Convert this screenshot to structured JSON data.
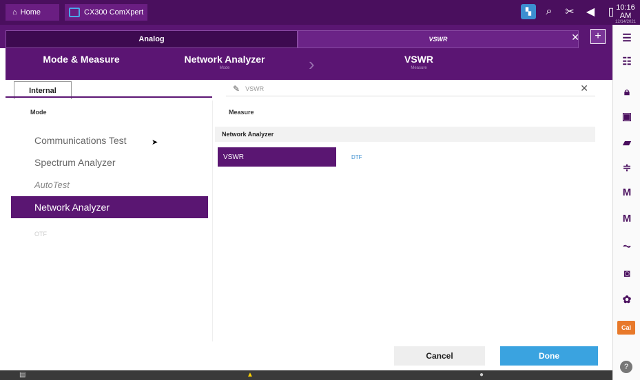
{
  "topbar": {
    "home_label": "Home",
    "app_label": "CX300 ComXpert",
    "clock_time": "10:16 AM",
    "clock_date": "12/14/2021",
    "status_icons": [
      "network-icon",
      "wifi-search-icon",
      "tools-icon",
      "volume-icon",
      "battery-icon"
    ]
  },
  "subtabs": {
    "tab1": "Analog",
    "tab2": "VSWR"
  },
  "breadcrumb": {
    "root": "Mode & Measure",
    "mode_value": "Network Analyzer",
    "mode_sub": "Mode",
    "measure_value": "VSWR",
    "measure_sub": "Measure"
  },
  "tabrow": {
    "internal_tab": "Internal",
    "search_value": "VSWR"
  },
  "mode": {
    "header": "Mode",
    "items": [
      {
        "label": "Communications Test"
      },
      {
        "label": "Spectrum Analyzer"
      },
      {
        "label": "AutoTest"
      },
      {
        "label": "Network Analyzer"
      },
      {
        "label": "OTF"
      }
    ]
  },
  "measure": {
    "header": "Measure",
    "group": "Network Analyzer",
    "selected": "VSWR",
    "alt": "DTF"
  },
  "footer": {
    "cancel": "Cancel",
    "done": "Done"
  },
  "sidebar": {
    "cal": "Cal",
    "help": "?"
  },
  "colors": {
    "brand_purple": "#5a1672",
    "accent_blue": "#3aa3e0",
    "cal_orange": "#e8792a"
  }
}
